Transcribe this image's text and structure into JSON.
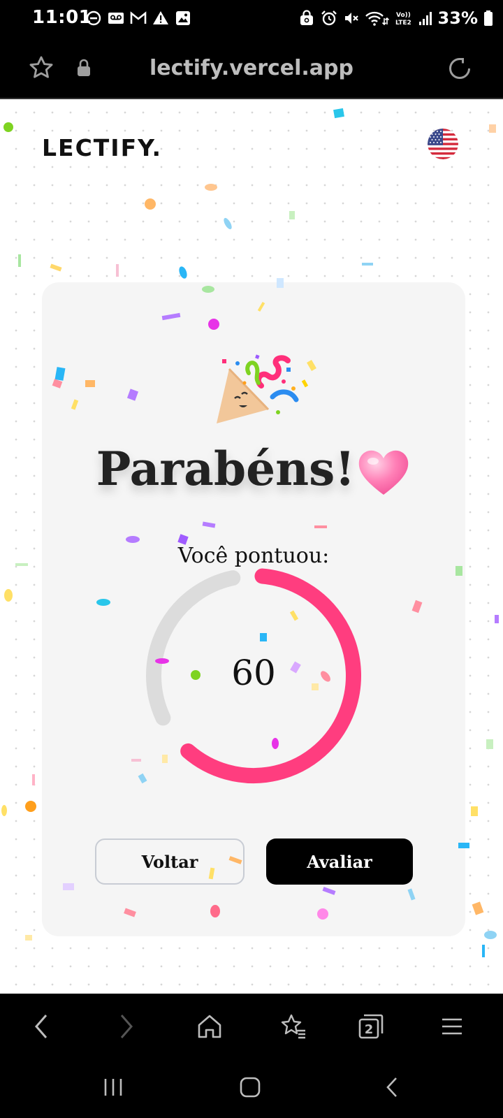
{
  "status_bar": {
    "time": "11:01",
    "battery": "33%",
    "left_icons": [
      "do-not-disturb-icon",
      "voicemail-icon",
      "gmail-icon",
      "alert-icon",
      "image-icon"
    ],
    "right_icons": [
      "secure-folder-icon",
      "alarm-icon",
      "mute-icon",
      "wifi-icon",
      "volte-lte2-icon",
      "signal-icon",
      "battery-icon"
    ],
    "network_label": "Vo)) LTE2"
  },
  "browser": {
    "url": "lectify.vercel.app"
  },
  "page": {
    "logo": "LECTIFY.",
    "language_flag": "us-flag-icon",
    "title": "Parabéns!",
    "subtitle": "Você pontuou:",
    "score": "60",
    "score_fraction": 0.6,
    "back_button": "Voltar",
    "rate_button": "Avaliar",
    "colors": {
      "gauge_fill": "#ff3d7f",
      "gauge_track": "#dcdcdc",
      "card_bg": "#f5f5f5",
      "primary_button": "#000000"
    }
  },
  "bottom_nav": {
    "tab_count": "2"
  }
}
